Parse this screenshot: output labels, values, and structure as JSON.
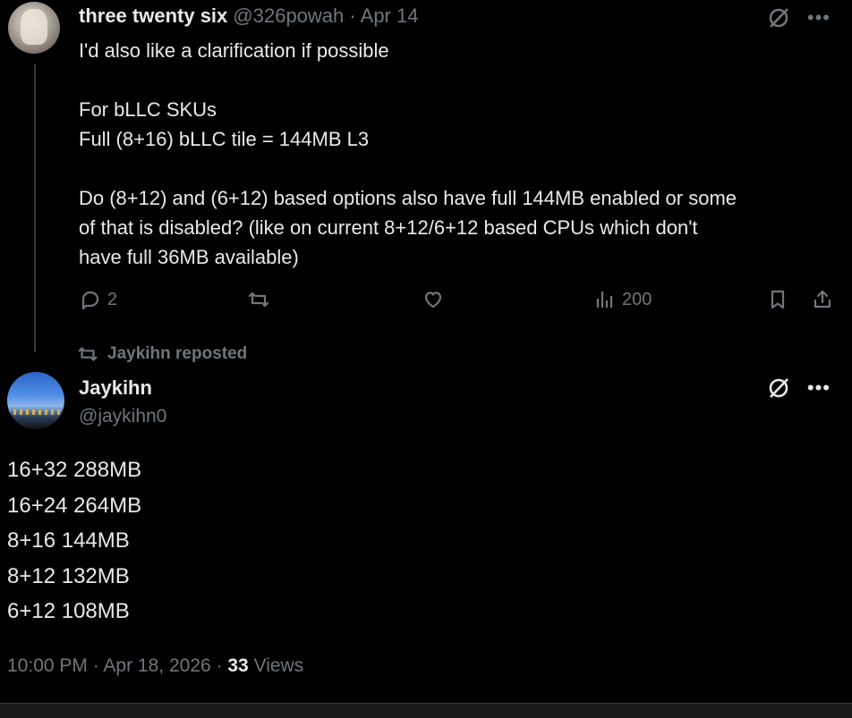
{
  "tweet1": {
    "display_name": "three twenty six",
    "handle": "@326powah",
    "separator": "·",
    "date": "Apr 14",
    "lines": [
      "I'd also like a clarification if possible",
      "",
      "For bLLC SKUs",
      "Full (8+16) bLLC tile = 144MB L3",
      "",
      "Do (8+12) and (6+12) based options also have full 144MB enabled or some",
      "of that is disabled? (like on current 8+12/6+12 based CPUs which don't",
      "have full 36MB available)"
    ],
    "actions": {
      "reply_count": "2",
      "repost_count": "",
      "like_count": "",
      "views_count": "200"
    },
    "icons": [
      "grok-icon",
      "more-icon",
      "reply-icon",
      "repost-icon",
      "like-icon",
      "views-icon",
      "bookmark-icon",
      "share-icon"
    ]
  },
  "repost_notice": "Jaykihn reposted",
  "tweet2": {
    "display_name": "Jaykihn",
    "handle": "@jaykihn0",
    "lines": [
      "16+32 288MB",
      "16+24 264MB",
      "8+16 144MB",
      "8+12 132MB",
      "6+12 108MB"
    ],
    "time": "10:00 PM",
    "sep": "·",
    "date": "Apr 18, 2026",
    "sep2": "·",
    "views_count": "33",
    "views_label": "Views"
  },
  "colors": {
    "background": "#000000",
    "text": "#e7e9ea",
    "muted": "#71767b"
  }
}
